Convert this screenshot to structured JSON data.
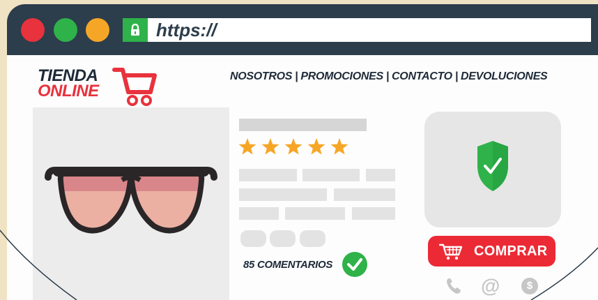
{
  "browser": {
    "url": "https://",
    "window_buttons": [
      "close",
      "minimize",
      "maximize"
    ]
  },
  "logo": {
    "line1": "TIENDA",
    "line2": "ONLINE",
    "icon": "shopping-cart-icon"
  },
  "nav": {
    "items": [
      "NOSOTROS",
      "PROMOCIONES",
      "CONTACTO",
      "DEVOLUCIONES"
    ],
    "separator": "|"
  },
  "product": {
    "image": "sunglasses",
    "rating": 5,
    "rating_max": 5,
    "comments_label": "85 COMENTARIOS"
  },
  "security": {
    "icon": "shield-check-icon"
  },
  "buy_button": {
    "label": "COMPRAR",
    "icon": "cart-icon"
  },
  "contact_icons": [
    {
      "icon": "phone-icon"
    },
    {
      "icon": "at-icon",
      "glyph": "@"
    },
    {
      "icon": "dollar-icon",
      "glyph": "$"
    }
  ],
  "colors": {
    "topbar": "#2c3d4b",
    "accent_red": "#e8323d",
    "accent_green": "#2fb24a",
    "accent_orange": "#f6a626",
    "star": "#f6a626",
    "background": "#efe3c4"
  }
}
